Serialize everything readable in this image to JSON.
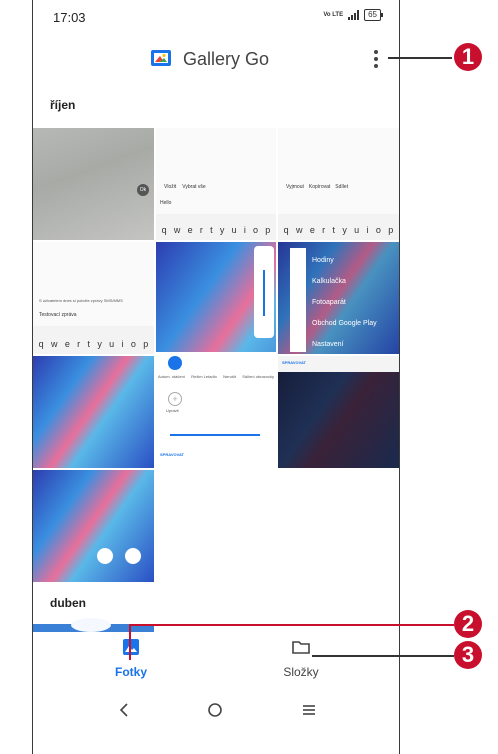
{
  "status": {
    "time": "17:03",
    "network": "Vo LTE",
    "battery": "65"
  },
  "app": {
    "title": "Gallery Go"
  },
  "sections": {
    "first": "říjen",
    "second": "duben"
  },
  "screens": {
    "lockscreen_badge": "Ok",
    "compose_bar_a": [
      "Vložit",
      "Vybrat vše"
    ],
    "compose_bar_b": [
      "Vyjmout",
      "Kopírovat",
      "Sdílet"
    ],
    "hint": "Hello",
    "compose_title": "Testovací zpráva",
    "compose_notice": "S uživatelem dnes si položte zprávy SMS/MMS",
    "keys": [
      "q",
      "w",
      "e",
      "r",
      "t",
      "y",
      "u",
      "i",
      "o",
      "p"
    ],
    "apps": [
      "Hodiny",
      "Kalkulačka",
      "Fotoaparát",
      "Obchod Google Play",
      "Nastavení"
    ],
    "manage": "SPRAVOVAT",
    "quick_tiles": [
      "Autom. otáčení",
      "Režim Letadlo",
      "Nerušit",
      "Sdílení obrazovky"
    ],
    "quick_edit": "Upravit"
  },
  "nav": {
    "photos": "Fotky",
    "folders": "Složky"
  },
  "callouts": [
    "1",
    "2",
    "3"
  ],
  "colors": {
    "accent": "#1a73e8",
    "callout": "#c8102e"
  }
}
